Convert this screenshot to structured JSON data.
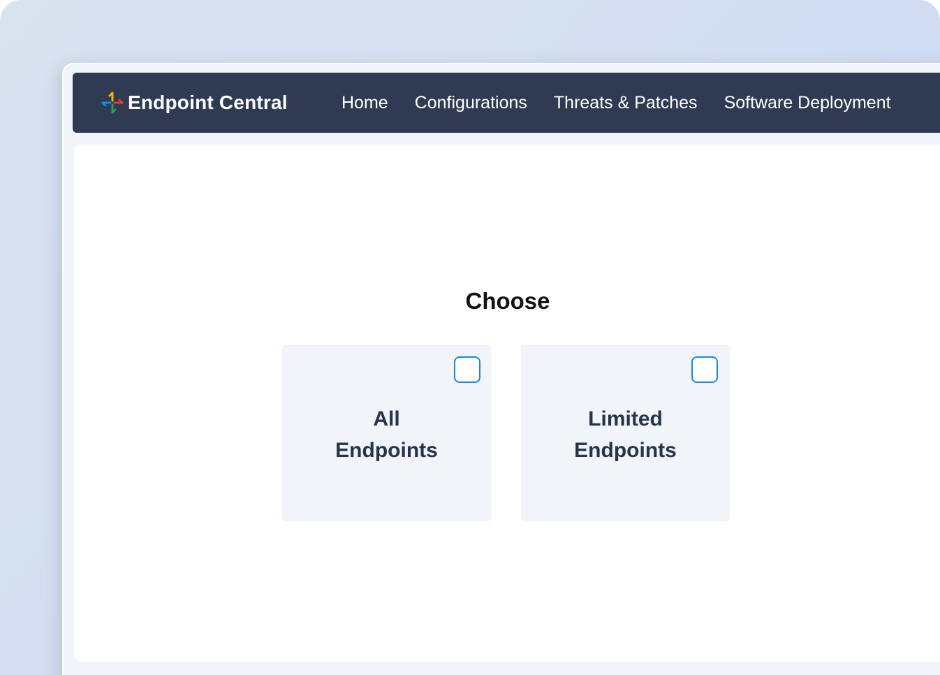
{
  "app": {
    "brand_name": "Endpoint Central",
    "brand_icon": "endpoint-central-logo-icon"
  },
  "nav": {
    "items": [
      {
        "label": "Home"
      },
      {
        "label": "Configurations"
      },
      {
        "label": "Threats & Patches"
      },
      {
        "label": "Software Deployment"
      }
    ]
  },
  "main": {
    "title": "Choose",
    "options": [
      {
        "line1": "All",
        "line2": "Endpoints",
        "checked": false
      },
      {
        "line1": "Limited",
        "line2": "Endpoints",
        "checked": false
      }
    ]
  },
  "colors": {
    "navbar": "#2f3b52",
    "accent": "#1a84e8",
    "card": "#f1f4f8",
    "label_text": "#26334a",
    "logo_yellow": "#f4b400",
    "logo_red": "#e53935",
    "logo_blue": "#1e88e5",
    "logo_green": "#2e9e4f"
  }
}
